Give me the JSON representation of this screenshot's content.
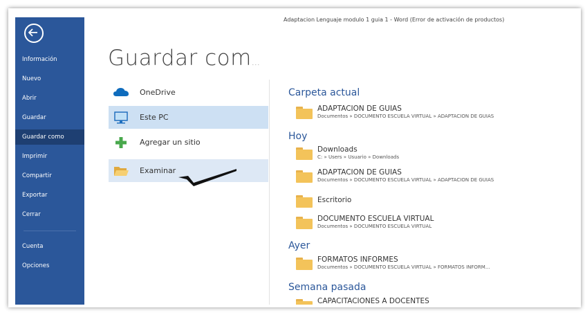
{
  "window": {
    "doc_title": "Adaptacion Lenguaje modulo 1 guia 1 - Word (Error de activación de productos)"
  },
  "sidebar": {
    "items": [
      {
        "label": "Información"
      },
      {
        "label": "Nuevo"
      },
      {
        "label": "Abrir"
      },
      {
        "label": "Guardar"
      },
      {
        "label": "Guardar como",
        "active": true
      },
      {
        "label": "Imprimir"
      },
      {
        "label": "Compartir"
      },
      {
        "label": "Exportar"
      },
      {
        "label": "Cerrar"
      },
      {
        "label": "Cuenta"
      },
      {
        "label": "Opciones"
      }
    ]
  },
  "main": {
    "title": "Guardar com",
    "title_ellipsis": "…",
    "locations": [
      {
        "label": "OneDrive",
        "icon": "onedrive-icon"
      },
      {
        "label": "Este PC",
        "icon": "pc-icon",
        "selected": true
      },
      {
        "label": "Agregar un sitio",
        "icon": "plus-icon"
      },
      {
        "label": "Examinar",
        "icon": "folder-open-icon",
        "hover": true
      }
    ]
  },
  "recent": {
    "sections": [
      {
        "heading": "Carpeta actual",
        "folders": [
          {
            "name": "ADAPTACION DE GUIAS",
            "path": "Documentos » DOCUMENTO ESCUELA VIRTUAL » ADAPTACION DE GUIAS"
          }
        ]
      },
      {
        "heading": "Hoy",
        "folders": [
          {
            "name": "Downloads",
            "path": "C: » Users » Usuario » Downloads"
          },
          {
            "name": "ADAPTACION DE GUIAS",
            "path": "Documentos » DOCUMENTO ESCUELA VIRTUAL » ADAPTACION DE GUIAS"
          },
          {
            "name": "Escritorio",
            "path": ""
          },
          {
            "name": "DOCUMENTO ESCUELA VIRTUAL",
            "path": "Documentos » DOCUMENTO ESCUELA VIRTUAL"
          }
        ]
      },
      {
        "heading": "Ayer",
        "folders": [
          {
            "name": "FORMATOS INFORMES",
            "path": "Documentos » DOCUMENTO ESCUELA VIRTUAL » FORMATOS INFORM..."
          }
        ]
      },
      {
        "heading": "Semana pasada",
        "folders": [
          {
            "name": "CAPACITACIONES A DOCENTES",
            "path": ""
          }
        ]
      }
    ]
  },
  "colors": {
    "sidebar": "#2b579a",
    "sidebar_active": "#1e3f72",
    "selected": "#cde0f3",
    "heading": "#2b579a",
    "folder": "#f3c35a"
  }
}
